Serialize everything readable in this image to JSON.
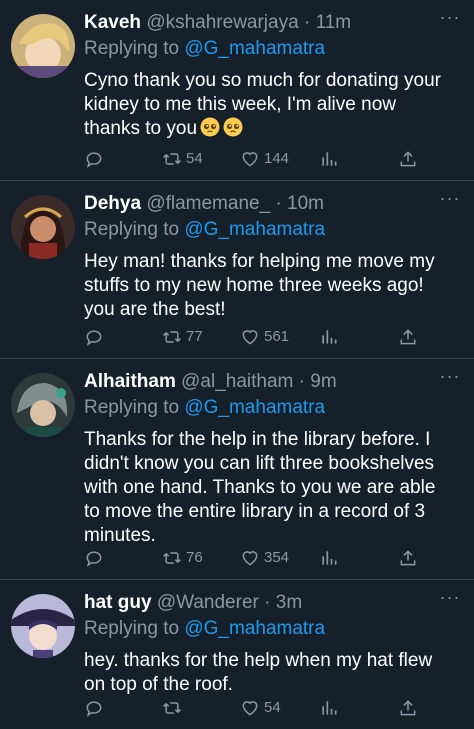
{
  "tweets": [
    {
      "name": "Kaveh",
      "handle": "@kshahrewarjaya",
      "separator": "·",
      "time": "11m",
      "replying_prefix": "Replying to",
      "replying_to": "@G_mahamatra",
      "text": "Cyno thank you so much for donating your kidney to me this week, I'm alive now thanks to you",
      "emojis": [
        "pleading-face-emoji",
        "pleading-face-emoji"
      ],
      "retweets": "54",
      "likes": "144"
    },
    {
      "name": "Dehya",
      "handle": "@flamemane_",
      "separator": "·",
      "time": "10m",
      "replying_prefix": "Replying to",
      "replying_to": "@G_mahamatra",
      "text": "Hey man! thanks for helping me move my stuffs to my new home three weeks ago! you are the best!",
      "retweets": "77",
      "likes": "561"
    },
    {
      "name": "Alhaitham",
      "handle": "@al_haitham",
      "separator": "·",
      "time": "9m",
      "replying_prefix": "Replying to",
      "replying_to": "@G_mahamatra",
      "text": "Thanks for the help in the library before. I didn't know you can lift three bookshelves with one hand. Thanks to you we are able to move the entire library in a record of 3 minutes.",
      "retweets": "76",
      "likes": "354"
    },
    {
      "name": "hat guy",
      "handle": "@Wanderer",
      "separator": "·",
      "time": "3m",
      "replying_prefix": "Replying to",
      "replying_to": "@G_mahamatra",
      "text": "hey. thanks for the help when my hat flew on top of the roof.",
      "retweets": "",
      "likes": "54"
    }
  ],
  "icons": {
    "reply": "reply-icon",
    "retweet": "retweet-icon",
    "like": "heart-icon",
    "analytics": "analytics-icon",
    "share": "share-icon",
    "more": "more-icon"
  },
  "colors": {
    "background": "#15202b",
    "text": "#ffffff",
    "secondary": "#8899a6",
    "accent": "#1d9bf0",
    "divider": "#38444d"
  }
}
